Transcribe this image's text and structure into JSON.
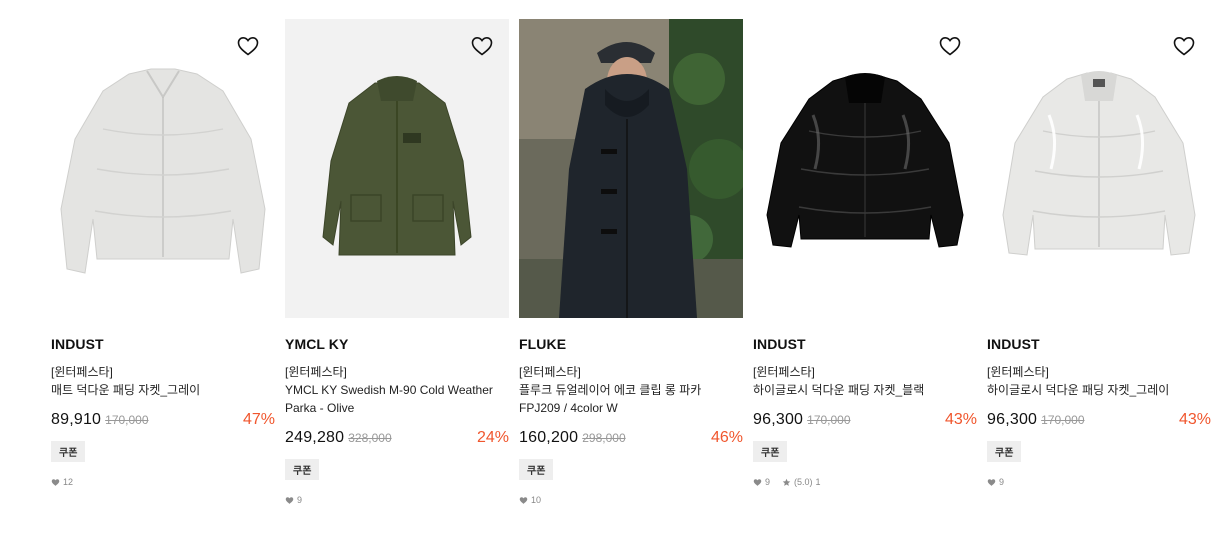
{
  "products": [
    {
      "brand": "INDUST",
      "tag": "[윈터페스타]",
      "name": "매트 덕다운 패딩 자켓_그레이",
      "price": "89,910",
      "original_price": "170,000",
      "discount": "47%",
      "coupon": "쿠폰",
      "likes": "12",
      "rating": "",
      "reviews": "",
      "icon": "heart-icon",
      "bg": "#ffffff",
      "accent": "#e6e6e6"
    },
    {
      "brand": "YMCL KY",
      "tag": "[윈터페스타]",
      "name": "YMCL KY Swedish M-90 Cold Weather Parka - Olive",
      "price": "249,280",
      "original_price": "328,000",
      "discount": "24%",
      "coupon": "쿠폰",
      "likes": "9",
      "rating": "",
      "reviews": "",
      "icon": "heart-icon",
      "bg": "#f2f2f2",
      "accent": "#4a5535"
    },
    {
      "brand": "FLUKE",
      "tag": "[윈터페스타]",
      "name": "플루크 듀얼레이어 에코 클립 롱 파카 FPJ209 / 4color W",
      "price": "160,200",
      "original_price": "298,000",
      "discount": "46%",
      "coupon": "쿠폰",
      "likes": "10",
      "rating": "",
      "reviews": "",
      "icon": "heart-icon",
      "bg": "#3a3a35",
      "accent": "#1d2228"
    },
    {
      "brand": "INDUST",
      "tag": "[윈터페스타]",
      "name": "하이글로시 덕다운 패딩 자켓_블랙",
      "price": "96,300",
      "original_price": "170,000",
      "discount": "43%",
      "coupon": "쿠폰",
      "likes": "9",
      "rating": "(5.0)",
      "reviews": "1",
      "icon": "heart-icon",
      "bg": "#ffffff",
      "accent": "#0d0d0d"
    },
    {
      "brand": "INDUST",
      "tag": "[윈터페스타]",
      "name": "하이글로시 덕다운 패딩 자켓_그레이",
      "price": "96,300",
      "original_price": "170,000",
      "discount": "43%",
      "coupon": "쿠폰",
      "likes": "9",
      "rating": "",
      "reviews": "",
      "icon": "heart-icon",
      "bg": "#ffffff",
      "accent": "#e9e9e9"
    }
  ],
  "colors": {
    "discount": "#f0562d",
    "strikethrough": "#999999",
    "coupon_bg": "#eeeeee"
  }
}
